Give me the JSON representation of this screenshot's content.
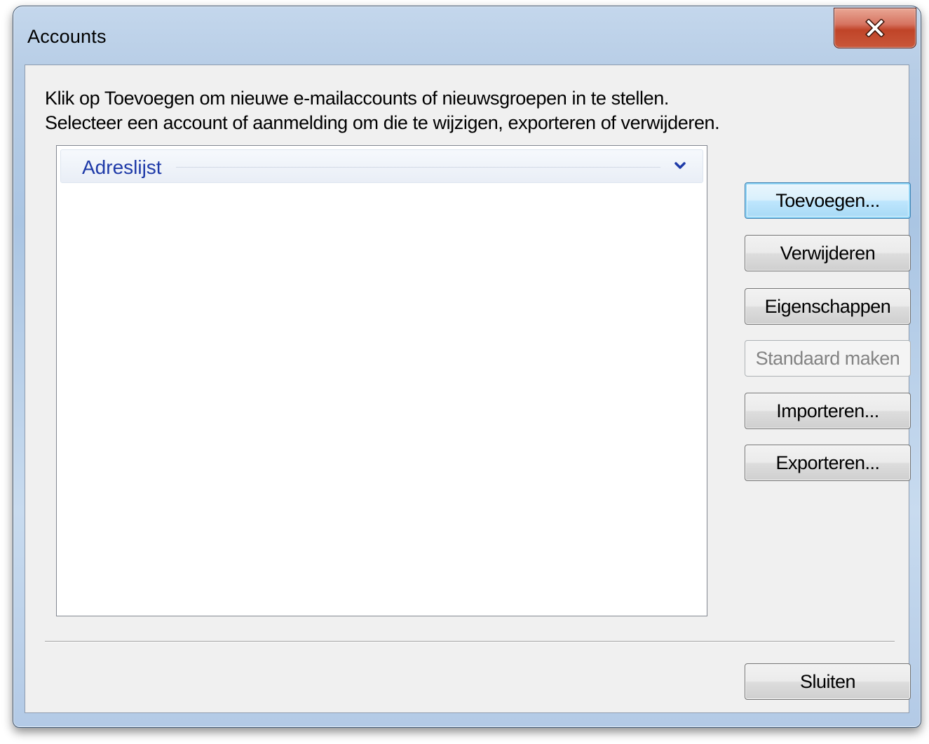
{
  "window": {
    "title": "Accounts",
    "close_icon": "close-x-icon"
  },
  "instructions": {
    "line1": "Klik op Toevoegen om nieuwe e-mailaccounts of nieuwsgroepen in te stellen.",
    "line2": "Selecteer een account of aanmelding om die te wijzigen, exporteren of verwijderen."
  },
  "account_list": {
    "group_label": "Adreslijst",
    "group_icon": "chevron-down-icon",
    "accent_color": "#1e3aa8",
    "items": []
  },
  "buttons": {
    "add": "Toevoegen...",
    "remove": "Verwijderen",
    "properties": "Eigenschappen",
    "set_default": "Standaard maken",
    "import": "Importeren...",
    "export": "Exporteren...",
    "close": "Sluiten"
  }
}
